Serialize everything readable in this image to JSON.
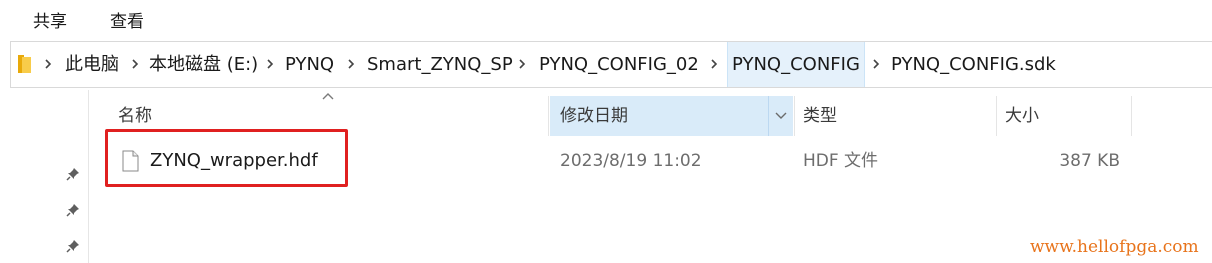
{
  "ribbon": {
    "share_label": "共享",
    "view_label": "查看"
  },
  "address_bar": {
    "crumbs": [
      "此电脑",
      "本地磁盘 (E:)",
      "PYNQ",
      "Smart_ZYNQ_SP",
      "PYNQ_CONFIG_02",
      "PYNQ_CONFIG",
      "PYNQ_CONFIG.sdk"
    ],
    "highlighted_crumb_index": 5
  },
  "columns": {
    "name": "名称",
    "date_modified": "修改日期",
    "type": "类型",
    "size": "大小",
    "sorted_column": "name",
    "active_column": "date_modified"
  },
  "files": [
    {
      "name": "ZYNQ_wrapper.hdf",
      "date_modified": "2023/8/19 11:02",
      "type": "HDF 文件",
      "size": "387 KB",
      "icon": "generic-file-icon",
      "highlighted": true
    }
  ],
  "colors": {
    "highlight_box": "#e02020",
    "active_column_bg": "#d9ebf9",
    "watermark": "#e8741c"
  },
  "watermark": "www.hellofpga.com"
}
